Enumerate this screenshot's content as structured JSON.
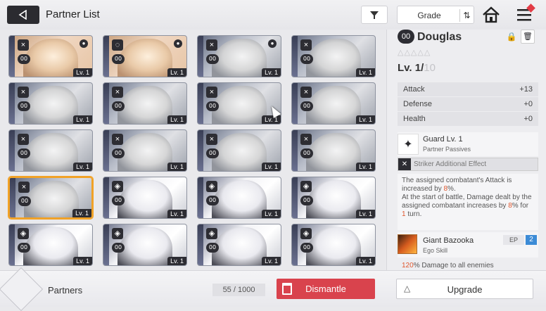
{
  "header": {
    "title": "Partner List",
    "sort_label": "Grade"
  },
  "cards": [
    {
      "kind": "warm",
      "type": "×",
      "locked": true,
      "lv": "Lv. 1",
      "rank": "00"
    },
    {
      "kind": "warm",
      "type": "◌",
      "locked": true,
      "lv": "Lv. 1",
      "rank": "00"
    },
    {
      "kind": "gray",
      "type": "×",
      "locked": true,
      "lv": "Lv. 1",
      "rank": "00"
    },
    {
      "kind": "gray",
      "type": "×",
      "locked": false,
      "lv": "Lv. 1",
      "rank": "00"
    },
    {
      "kind": "gray",
      "type": "×",
      "locked": false,
      "lv": "Lv. 1",
      "rank": "00"
    },
    {
      "kind": "gray",
      "type": "×",
      "locked": false,
      "lv": "Lv. 1",
      "rank": "00"
    },
    {
      "kind": "gray",
      "type": "×",
      "locked": false,
      "lv": "Lv. 1",
      "rank": "00"
    },
    {
      "kind": "gray",
      "type": "×",
      "locked": false,
      "lv": "Lv. 1",
      "rank": "00"
    },
    {
      "kind": "gray",
      "type": "×",
      "locked": false,
      "lv": "Lv. 1",
      "rank": "00"
    },
    {
      "kind": "gray",
      "type": "×",
      "locked": false,
      "lv": "Lv. 1",
      "rank": "00"
    },
    {
      "kind": "gray",
      "type": "×",
      "locked": false,
      "lv": "Lv. 1",
      "rank": "00"
    },
    {
      "kind": "gray",
      "type": "×",
      "locked": false,
      "lv": "Lv. 1",
      "rank": "00"
    },
    {
      "kind": "gray",
      "type": "×",
      "locked": false,
      "lv": "Lv. 1",
      "rank": "00",
      "selected": true
    },
    {
      "kind": "white",
      "type": "◈",
      "locked": false,
      "lv": "Lv. 1",
      "rank": "00"
    },
    {
      "kind": "white",
      "type": "◈",
      "locked": false,
      "lv": "Lv. 1",
      "rank": "00"
    },
    {
      "kind": "white",
      "type": "◈",
      "locked": false,
      "lv": "Lv. 1",
      "rank": "00"
    },
    {
      "kind": "white",
      "type": "◈",
      "locked": false,
      "lv": "Lv. 1",
      "rank": "00"
    },
    {
      "kind": "white",
      "type": "◈",
      "locked": false,
      "lv": "Lv. 1",
      "rank": "00"
    },
    {
      "kind": "white",
      "type": "◈",
      "locked": false,
      "lv": "Lv. 1",
      "rank": "00"
    },
    {
      "kind": "white",
      "type": "◈",
      "locked": false,
      "lv": "Lv. 1",
      "rank": "00"
    }
  ],
  "detail": {
    "rank": "00",
    "name": "Douglas",
    "stars": "△△△△△",
    "level_prefix": "Lv. 1/",
    "level_max": "10",
    "stats": [
      {
        "label": "Attack",
        "value": "+13"
      },
      {
        "label": "Defense",
        "value": "+0"
      },
      {
        "label": "Health",
        "value": "+0"
      }
    ],
    "passive_name": "Guard Lv. 1",
    "passive_sub": "Partner Passives",
    "striker_label": "Striker Additional Effect",
    "desc_1": "The assigned combatant's Attack is increased by ",
    "desc_1_hl": "8",
    "desc_1_end": "%.",
    "desc_2": "At the start of battle, Damage dealt by the assigned combatant increases by ",
    "desc_2_hl": "8",
    "desc_2_mid": "% for ",
    "desc_2_hl2": "1",
    "desc_2_end": " turn.",
    "ego_name": "Giant Bazooka",
    "ego_sub": "Ego Skill",
    "ep_label": "EP",
    "ep_value": "2",
    "ego_desc_hl": "120",
    "ego_desc": "% Damage to all enemies"
  },
  "footer": {
    "partners_label": "Partners",
    "count": "55 / 1000",
    "dismantle_label": "Dismantle",
    "upgrade_label": "Upgrade"
  },
  "colors": {
    "accent_red": "#d9434d",
    "selection": "#f1a227",
    "ep_blue": "#3c8bd6"
  }
}
